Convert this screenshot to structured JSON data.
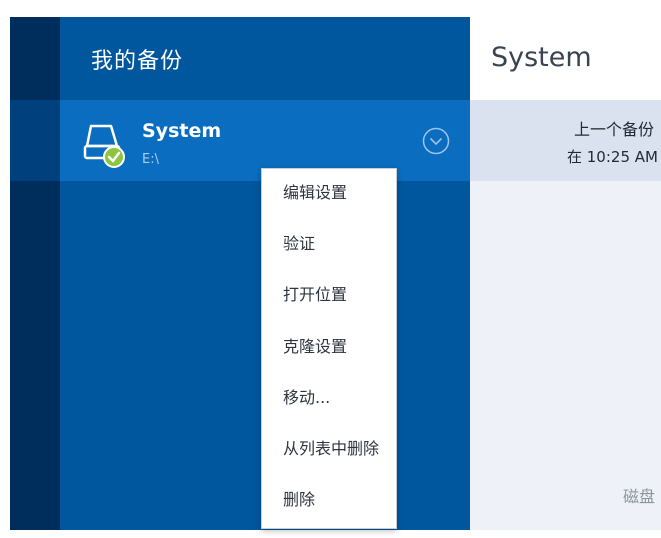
{
  "sidebar": {
    "title": "我的备份",
    "items": [
      {
        "name": "System",
        "path": "E:\\"
      }
    ]
  },
  "details": {
    "title": "System",
    "last_backup_label": "上一个备份",
    "last_backup_time": "在 10:25 AM",
    "disk_label": "磁盘"
  },
  "context_menu": {
    "items": [
      "编辑设置",
      "验证",
      "打开位置",
      "克隆设置",
      "移动...",
      "从列表中删除",
      "删除"
    ]
  },
  "colors": {
    "nav_strip": "#002e5c",
    "backups_panel": "#00579e",
    "selected_item": "#0a6dbf",
    "status_ok": "#8cc63f"
  }
}
